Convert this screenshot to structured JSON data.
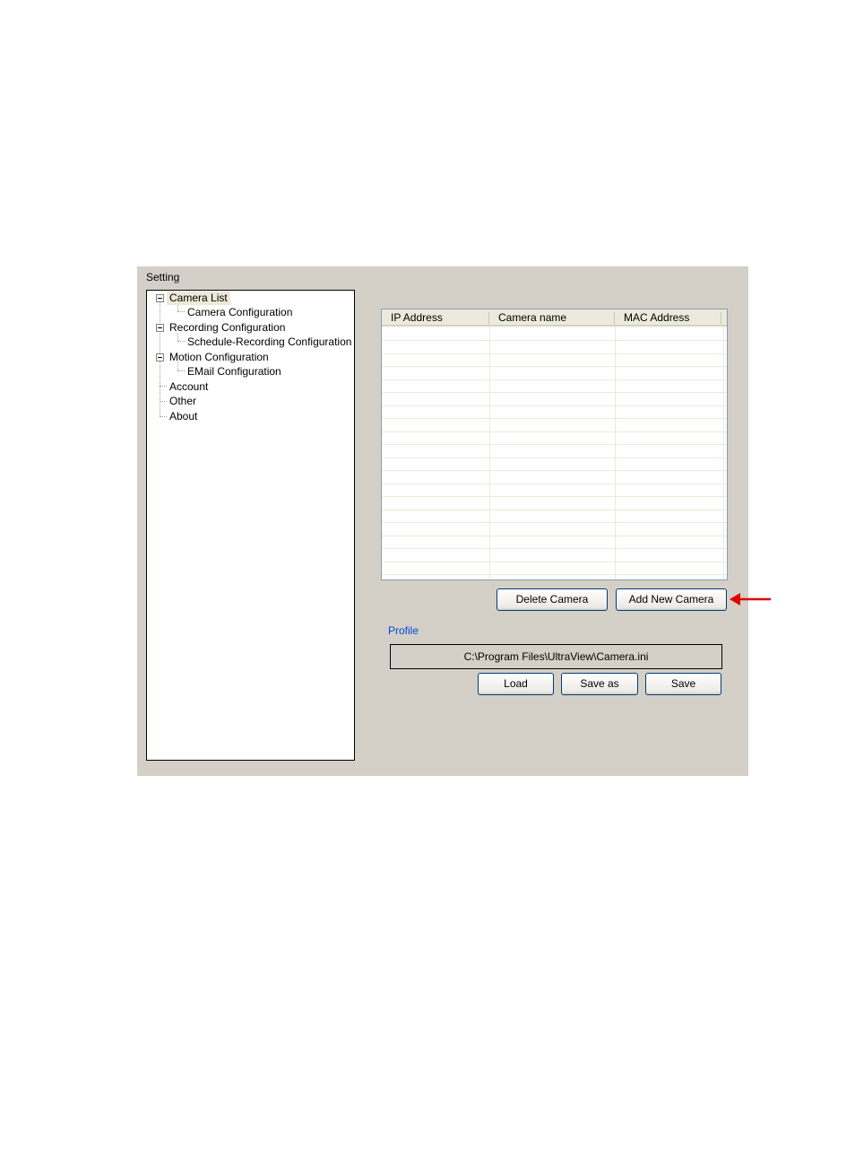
{
  "window": {
    "title": "Setting"
  },
  "tree": {
    "items": [
      {
        "label": "Camera List",
        "expanded": true
      },
      {
        "label": "Camera Configuration"
      },
      {
        "label": "Recording Configuration",
        "expanded": true
      },
      {
        "label": "Schedule-Recording Configuration"
      },
      {
        "label": "Motion Configuration",
        "expanded": true
      },
      {
        "label": "EMail Configuration"
      },
      {
        "label": "Account"
      },
      {
        "label": "Other"
      },
      {
        "label": "About"
      }
    ],
    "selected": "Camera List"
  },
  "camera_table": {
    "columns": [
      "IP Address",
      "Camera name",
      "MAC Address"
    ],
    "rows": []
  },
  "buttons": {
    "delete_camera": "Delete Camera",
    "add_new_camera": "Add New Camera",
    "load": "Load",
    "save_as": "Save as",
    "save": "Save"
  },
  "profile": {
    "label": "Profile",
    "path": "C:\\Program Files\\UltraView\\Camera.ini"
  },
  "annotation": {
    "arrow_color": "#e00000",
    "arrow_icon": "left-arrow-icon"
  }
}
